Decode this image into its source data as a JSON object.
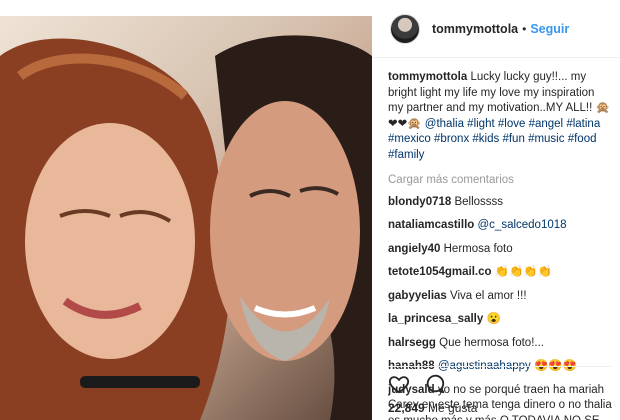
{
  "post": {
    "username": "tommymottola",
    "follow_label": "Seguir",
    "separator": "•",
    "caption_user": "tommymottola",
    "caption_text": "Lucky lucky guy!!... my bright light my life my love my inspiration my partner and my motivation..MY ALL!!",
    "caption_emoji": "🙊 ❤❤🙊",
    "caption_mention": "@thalia",
    "hashtags": [
      "#light",
      "#love",
      "#angel",
      "#latina",
      "#mexico",
      "#bronx",
      "#kids",
      "#fun",
      "#music",
      "#food",
      "#family"
    ],
    "load_more": "Cargar más comentarios",
    "likes_count": "22,849",
    "likes_label": "Me gusta"
  },
  "comments": [
    {
      "user": "blondy0718",
      "text": "Bellossss"
    },
    {
      "user": "nataliamcastillo",
      "text": "@c_salcedo1018",
      "mention": true
    },
    {
      "user": "angiely40",
      "text": "Hermosa foto"
    },
    {
      "user": "tetote1054gmail.co",
      "text": "👏👏👏👏"
    },
    {
      "user": "gabyyelias",
      "text": "Viva el amor !!!"
    },
    {
      "user": "la_princesa_sally",
      "text": "😮"
    },
    {
      "user": "halrsegg",
      "text": "Que hermosa foto!..."
    },
    {
      "user": "hanah88",
      "text": "@agustinaahappy 😍😍😍",
      "mention": true
    },
    {
      "user": "judysald",
      "text": "yo no se porqué traen ha mariah Carey en este tema tenga dinero o no thalia es mucho más y más O TODAVIA NO SE"
    }
  ],
  "icons": {
    "like": "heart-icon",
    "comment": "comment-icon"
  }
}
